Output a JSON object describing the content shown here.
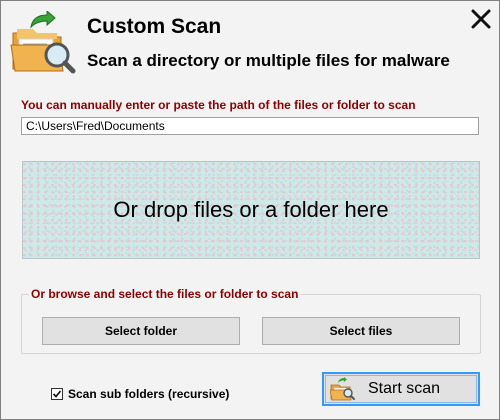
{
  "header": {
    "title": "Custom Scan",
    "subtitle": "Scan a directory or multiple files for malware"
  },
  "path": {
    "label": "You can manually enter or paste the path of the files or folder to scan",
    "value": "C:\\Users\\Fred\\Documents"
  },
  "drop_zone": {
    "text": "Or drop files or a folder here"
  },
  "browse": {
    "label": "Or browse and select the files or folder to scan",
    "select_folder": "Select folder",
    "select_files": "Select files"
  },
  "options": {
    "scan_subfolders_label": "Scan sub folders (recursive)",
    "scan_subfolders_checked": true
  },
  "actions": {
    "start_scan": "Start scan"
  },
  "icons": {
    "app": "folder-scan-icon",
    "close": "close-icon",
    "start": "folder-scan-icon"
  },
  "colors": {
    "section_label": "#8b0000",
    "focus_border": "#3399ff",
    "drop_zone_bg": "#cfe9e9"
  }
}
